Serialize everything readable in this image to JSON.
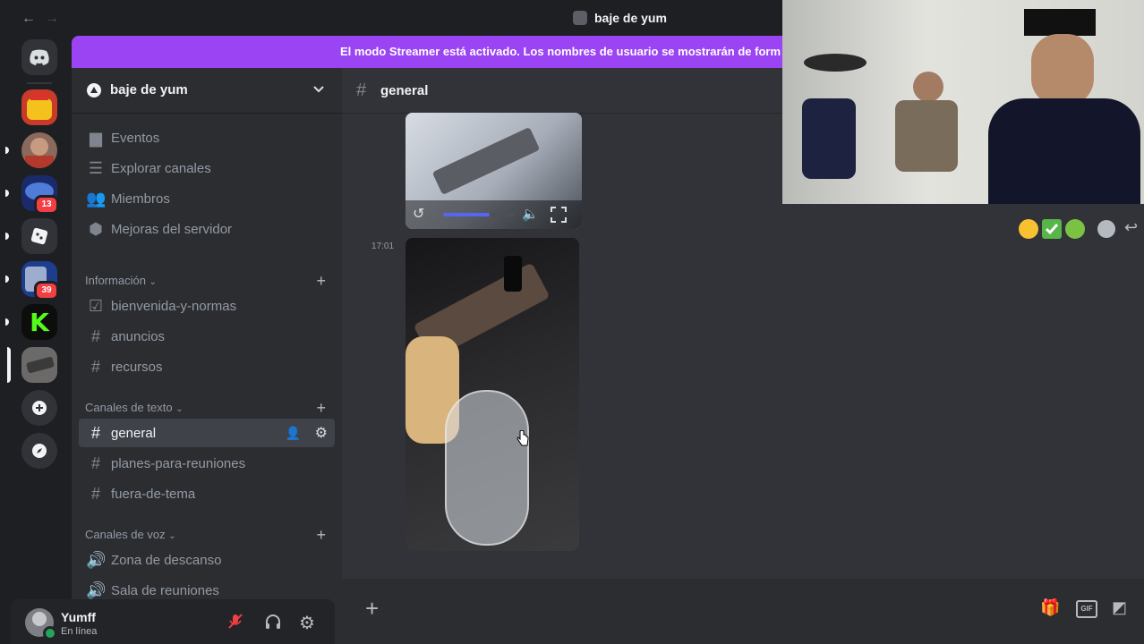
{
  "window": {
    "title": "baje de yum",
    "back_icon": "←",
    "forward_icon": "→"
  },
  "banner": {
    "text": "El modo Streamer está activado. Los nombres de usuario se mostrarán de form"
  },
  "servers": [
    {
      "name": "server-1",
      "badge": null
    },
    {
      "name": "server-2",
      "badge": null
    },
    {
      "name": "server-3",
      "badge": "13"
    },
    {
      "name": "server-4",
      "badge": null
    },
    {
      "name": "server-5",
      "badge": "39"
    },
    {
      "name": "server-6",
      "badge": null
    },
    {
      "name": "server-7-selected",
      "badge": null
    }
  ],
  "server": {
    "name": "baje de yum"
  },
  "sidebar": {
    "top_items": [
      {
        "label": "Eventos",
        "icon": "calendar-icon"
      },
      {
        "label": "Explorar canales",
        "icon": "browse-channels-icon"
      },
      {
        "label": "Miembros",
        "icon": "members-icon"
      },
      {
        "label": "Mejoras del servidor",
        "icon": "boost-icon"
      }
    ],
    "categories": [
      {
        "label": "Información",
        "channels": [
          {
            "label": "bienvenida-y-normas",
            "icon": "rules-icon"
          },
          {
            "label": "anuncios",
            "icon": "hash-icon"
          },
          {
            "label": "recursos",
            "icon": "hash-icon"
          }
        ]
      },
      {
        "label": "Canales de texto",
        "channels": [
          {
            "label": "general",
            "icon": "hash-icon",
            "active": true
          },
          {
            "label": "planes-para-reuniones",
            "icon": "hash-icon"
          },
          {
            "label": "fuera-de-tema",
            "icon": "hash-icon"
          }
        ]
      },
      {
        "label": "Canales de voz",
        "channels": [
          {
            "label": "Zona de descanso",
            "icon": "speaker-icon"
          },
          {
            "label": "Sala de reuniones",
            "icon": "speaker-icon"
          }
        ]
      }
    ]
  },
  "user": {
    "name": "Yumff",
    "status": "En línea"
  },
  "chat": {
    "channel_name": "general",
    "message_time": "17:01",
    "video_progress": 0.65
  },
  "colors": {
    "banner": "#9b44f3",
    "accent": "#5865f2",
    "online": "#23a55a",
    "badge": "#f23f43"
  }
}
